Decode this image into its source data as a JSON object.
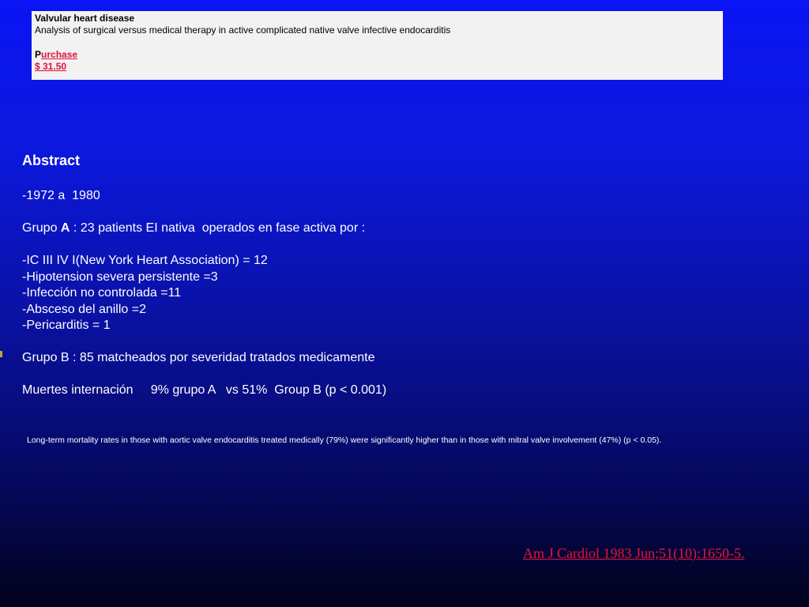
{
  "header": {
    "title": "Valvular heart disease",
    "subtitle": "Analysis of surgical versus medical therapy in active complicated native valve infective endocarditis",
    "purchase_prefix": "P",
    "purchase_link": "urchase",
    "price": "$ 31.50"
  },
  "abstract": {
    "heading": "Abstract",
    "years": "-1972 a  1980",
    "group_a_prefix": "Grupo ",
    "group_a_letter": "A",
    "group_a_text": " : 23 patients EI nativa  operados en fase activa por :",
    "criteria": [
      "-IC III IV I(New York Heart Association) = 12",
      "-Hipotension severa persistente =3",
      "-Infección no controlada =11",
      "-Absceso del anillo =2",
      "-Pericarditis = 1"
    ],
    "group_b": "Grupo B : 85 matcheados por severidad tratados medicamente",
    "deaths": "Muertes internación     9% grupo A   vs 51%  Group B (p < 0.001)"
  },
  "note": "Long-term mortality rates in those with aortic valve endocarditis treated medically (79%) were significantly higher than in those with mitral valve involvement (47%) (p < 0.05).",
  "citation": "Am J Cardiol 1983 Jun;51(10):1650-5. "
}
